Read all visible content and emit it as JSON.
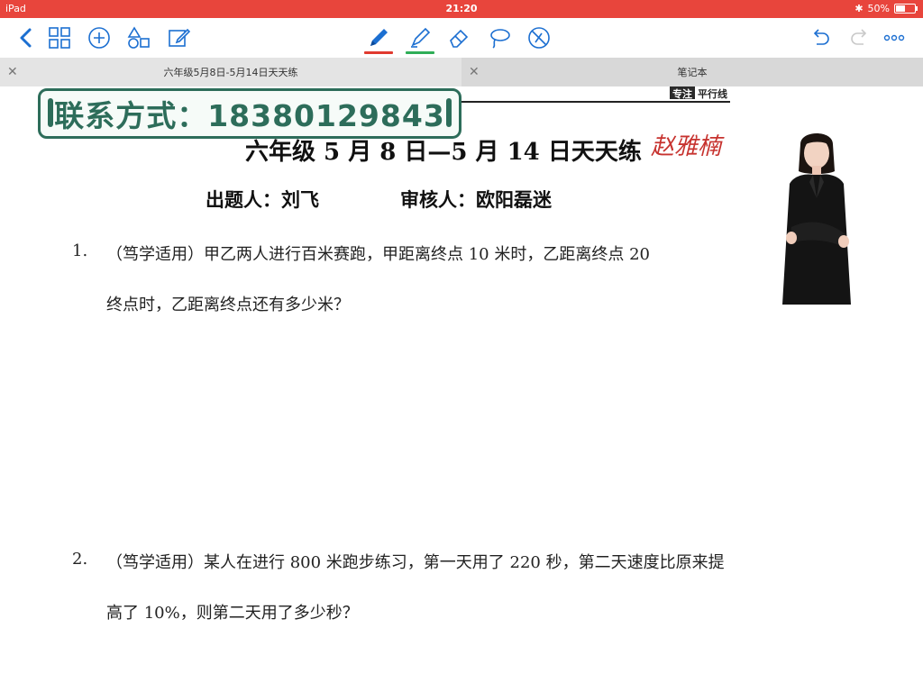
{
  "status_bar": {
    "device": "iPad",
    "time": "21:20",
    "battery": "50%",
    "battery_level": 0.5
  },
  "toolbar": {
    "back_icon": "chevron-left-icon",
    "grid_icon": "grid-icon",
    "add_icon": "plus-circle-icon",
    "shapes_icon": "shapes-icon",
    "edit_icon": "edit-icon",
    "pen_icon": "pen-icon",
    "highlighter_icon": "highlighter-icon",
    "eraser_icon": "eraser-icon",
    "lasso_icon": "lasso-icon",
    "no_touch_icon": "no-touch-icon",
    "undo_icon": "undo-icon",
    "redo_icon": "redo-icon",
    "more_icon": "more-icon",
    "pen_color": "#e03a2f",
    "highlighter_color": "#2fae57"
  },
  "tabs": [
    {
      "label": "六年级5月8日-5月14日天天练",
      "active": true
    },
    {
      "label": "笔记本",
      "active": false
    }
  ],
  "document": {
    "brand": {
      "part1": "专注",
      "part2": "平行线"
    },
    "contact_banner": "联系方式：18380129843",
    "title": "六年级 5 月 8 日—5 月 14 日天天练",
    "signature": "赵雅楠",
    "author": "出题人：刘飞",
    "reviewer": "审核人：欧阳磊迷",
    "questions": [
      {
        "number": "1.",
        "line1": "（笃学适用）甲乙两人进行百米赛跑，甲距离终点 10 米时，乙距离终点 20",
        "line2": "终点时，乙距离终点还有多少米？"
      },
      {
        "number": "2.",
        "line1": "（笃学适用）某人在进行 800 米跑步练习，第一天用了 220 秒，第二天速度比原来提",
        "line2": "高了 10%，则第二天用了多少秒？"
      }
    ]
  }
}
